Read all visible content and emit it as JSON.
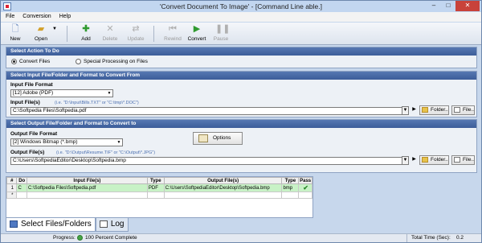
{
  "window": {
    "title": "'Convert Document To Image' - [Command Line able.]",
    "controls": [
      "–",
      "□",
      "✕"
    ]
  },
  "menu": [
    "File",
    "Conversion",
    "Help"
  ],
  "toolbar": {
    "new": "New",
    "open": "Open",
    "add": "Add",
    "delete": "Delete",
    "update": "Update",
    "rewind": "Rewind",
    "convert": "Convert",
    "pause": "Pause"
  },
  "action": {
    "header": "Select Action To Do",
    "opt1": "Convert Files",
    "opt2": "Special Processing on Files",
    "selected": "Convert Files"
  },
  "input": {
    "header": "Select Input File/Folder and Format to Convert From",
    "format_label": "Input File Format",
    "format_value": "[12] Adobe (PDF)",
    "files_label": "Input File(s)",
    "files_hint": "(i.e. \"D:\\Input\\Bills.TXT\" or \"C:\\tmp\\*.DOC\")",
    "files_value": "C:\\Softpedia Files\\Softpedia.pdf",
    "folder_btn": "Folder..",
    "file_btn": "File.."
  },
  "output": {
    "header": "Select Output File/Folder and Format to Convert to",
    "format_label": "Output File Format",
    "format_value": "[2] Windows Bitmap (*.bmp)",
    "options_btn": "Options",
    "files_label": "Output File(s)",
    "files_hint": "(i.e. \"D:\\Output\\Resume.TIF\" or \"C:\\Output\\*.JPG\")",
    "files_value": "C:\\Users\\SoftpediaEditor\\Desktop\\Softpedia.bmp",
    "folder_btn": "Folder..",
    "file_btn": "File.."
  },
  "grid": {
    "headers": [
      "#",
      "Do",
      "Input File(s)",
      "Type",
      "Output File(s)",
      "Type",
      "Pass"
    ],
    "rows": [
      [
        "1",
        "C",
        "C:\\Softpedia Files\\Softpedia.pdf",
        "PDF",
        "C:\\Users\\SoftpediaEditor\\Desktop\\Softpedia.bmp",
        "bmp",
        "✔"
      ],
      [
        "*",
        "",
        "",
        "",
        "",
        "",
        ""
      ]
    ]
  },
  "tabs": [
    "Select Files/Folders",
    "Log"
  ],
  "status": {
    "progress_label": "Progress:",
    "progress_text": "100 Percent Complete",
    "time_label": "Total Time (Sec):",
    "time_value": "0.2"
  },
  "colors": {
    "section_header": "#4a6ca8",
    "row_done": "#c8f2c6",
    "close": "#c8423a"
  }
}
